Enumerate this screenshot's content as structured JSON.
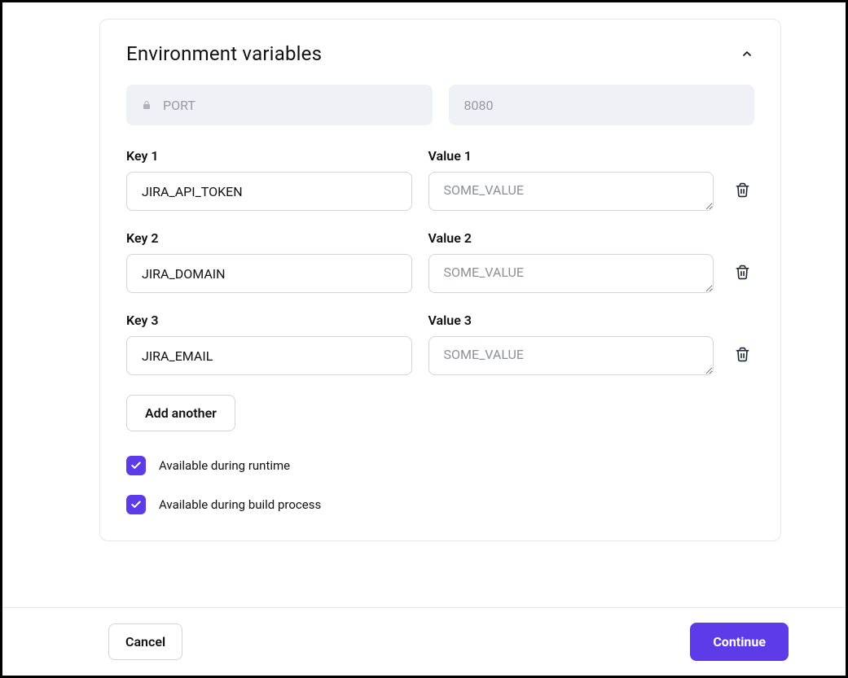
{
  "panel": {
    "title": "Environment variables",
    "locked": {
      "key": "PORT",
      "value": "8080"
    },
    "vars": [
      {
        "key_label": "Key 1",
        "key_value": "JIRA_API_TOKEN",
        "value_label": "Value 1",
        "value_placeholder": "SOME_VALUE"
      },
      {
        "key_label": "Key 2",
        "key_value": "JIRA_DOMAIN",
        "value_label": "Value 2",
        "value_placeholder": "SOME_VALUE"
      },
      {
        "key_label": "Key 3",
        "key_value": "JIRA_EMAIL",
        "value_label": "Value 3",
        "value_placeholder": "SOME_VALUE"
      }
    ],
    "add_label": "Add another",
    "checkbox_runtime": "Available during runtime",
    "checkbox_build": "Available during build process"
  },
  "footer": {
    "cancel": "Cancel",
    "continue": "Continue"
  },
  "colors": {
    "accent": "#5d3be8"
  }
}
